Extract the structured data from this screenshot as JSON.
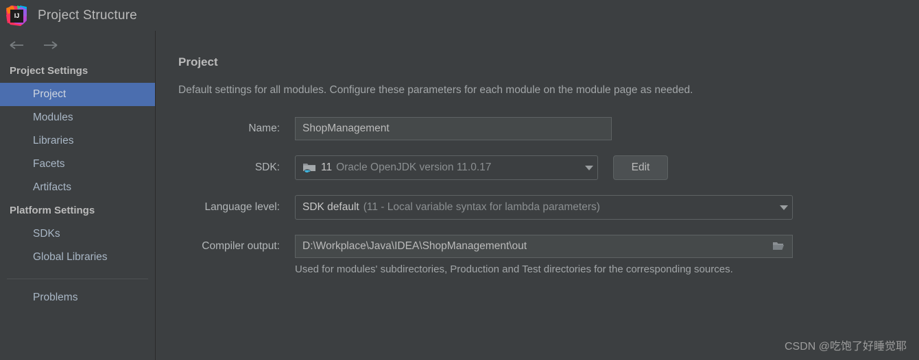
{
  "window": {
    "title": "Project Structure",
    "logo_icon": "intellij-idea-logo"
  },
  "nav": {
    "back_icon": "arrow-left-icon",
    "forward_icon": "arrow-right-icon"
  },
  "sidebar": {
    "groups": [
      {
        "title": "Project Settings",
        "items": [
          {
            "label": "Project",
            "selected": true
          },
          {
            "label": "Modules",
            "selected": false
          },
          {
            "label": "Libraries",
            "selected": false
          },
          {
            "label": "Facets",
            "selected": false
          },
          {
            "label": "Artifacts",
            "selected": false
          }
        ]
      },
      {
        "title": "Platform Settings",
        "items": [
          {
            "label": "SDKs",
            "selected": false
          },
          {
            "label": "Global Libraries",
            "selected": false
          }
        ]
      }
    ],
    "problems_label": "Problems"
  },
  "main": {
    "title": "Project",
    "description": "Default settings for all modules. Configure these parameters for each module on the module page as needed.",
    "name_row": {
      "label": "Name:",
      "value": "ShopManagement"
    },
    "sdk_row": {
      "label": "SDK:",
      "icon": "jdk-folder-icon",
      "version": "11",
      "detail": "Oracle OpenJDK version 11.0.17",
      "dropdown_icon": "chevron-down-icon",
      "edit_label": "Edit"
    },
    "language_level_row": {
      "label": "Language level:",
      "value": "SDK default",
      "detail": "(11 - Local variable syntax for lambda parameters)",
      "dropdown_icon": "chevron-down-icon"
    },
    "compiler_output_row": {
      "label": "Compiler output:",
      "value": "D:\\Workplace\\Java\\IDEA\\ShopManagement\\out",
      "browse_icon": "folder-open-icon",
      "helper_text": "Used for modules' subdirectories, Production and Test directories for the corresponding sources."
    }
  },
  "watermark": {
    "text": "CSDN @吃饱了好睡觉耶"
  },
  "colors": {
    "background": "#3c3f41",
    "selection": "#4b6eaf",
    "text": "#bbbbbb",
    "text_dim": "#8b8f91",
    "field_background": "#45494a",
    "border": "#5e6364"
  }
}
